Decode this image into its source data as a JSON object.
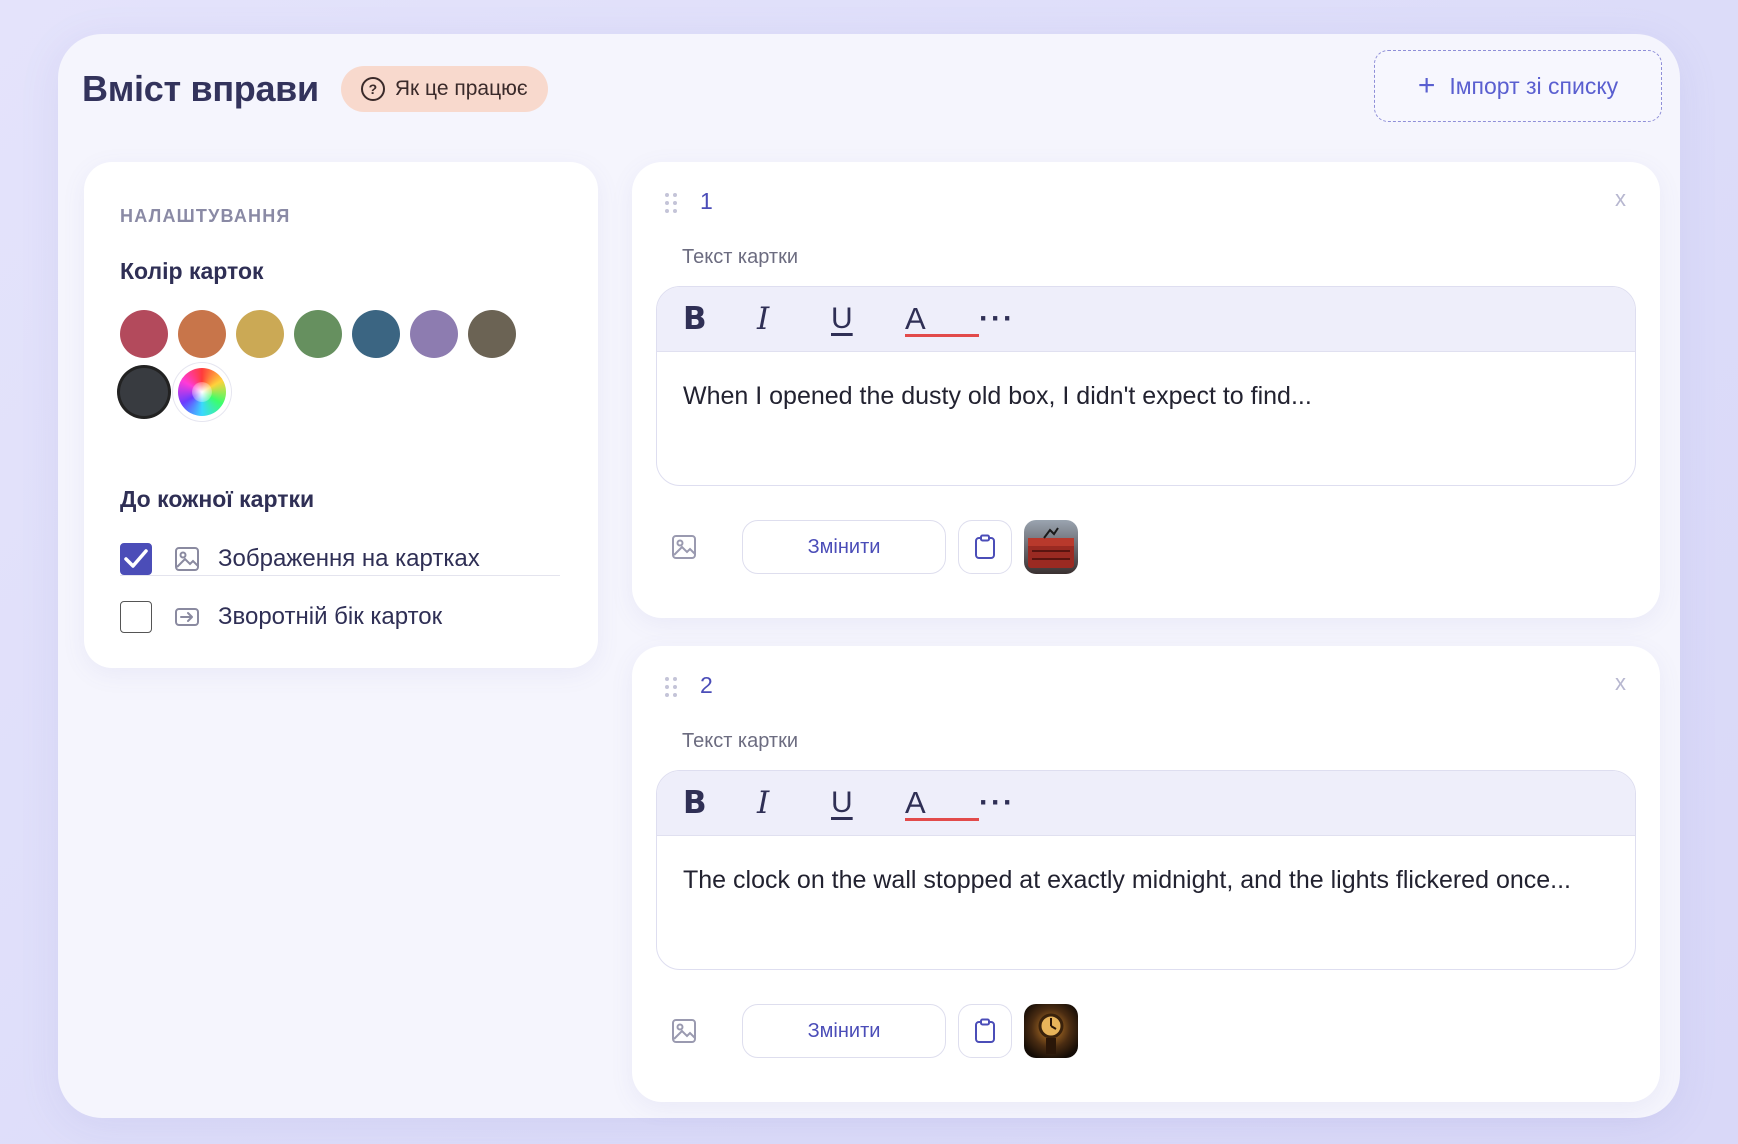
{
  "header": {
    "title": "Вміст вправи",
    "how_label": "Як це працює",
    "import_label": "Імпорт зі списку"
  },
  "settings": {
    "heading": "НАЛАШТУВАННЯ",
    "color_title": "Колір карток",
    "colors": [
      "#b34a5c",
      "#c8754a",
      "#cba955",
      "#66905f",
      "#3b6582",
      "#8d7cb0",
      "#6b6354",
      "#383b40"
    ],
    "selected_color": "#383b40",
    "each_card_title": "До кожної картки",
    "options": [
      {
        "label": "Зображення на картках",
        "checked": true,
        "icon": "image-icon"
      },
      {
        "label": "Зворотній бік карток",
        "checked": false,
        "icon": "flip-card-icon"
      }
    ]
  },
  "cards": [
    {
      "number": "1",
      "close": "x",
      "field_label": "Текст картки",
      "text": "When I opened the dusty old box, I didn't expect to find...",
      "change_label": "Змінити",
      "thumbnail": "old-box-thumbnail"
    },
    {
      "number": "2",
      "close": "x",
      "field_label": "Текст картки",
      "text": "The clock on the wall stopped at exactly midnight, and the lights flickered once...",
      "change_label": "Змінити",
      "thumbnail": "clock-thumbnail"
    }
  ],
  "toolbar": {
    "bold": "B",
    "italic": "I",
    "underline": "U",
    "color": "A",
    "more": "···"
  },
  "accent": "#4b4db8"
}
